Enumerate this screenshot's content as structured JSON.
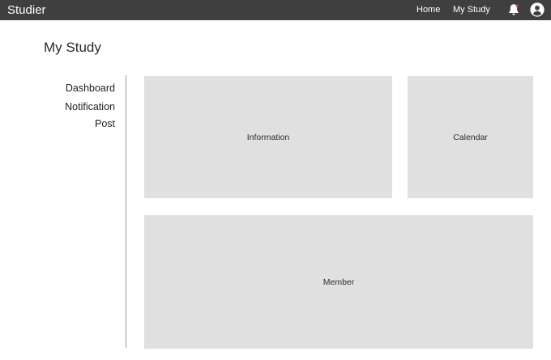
{
  "header": {
    "brand": "Studier",
    "nav": {
      "home": "Home",
      "my_study": "My Study"
    },
    "icons": {
      "notifications": "bell-icon",
      "account": "user-circle-icon"
    },
    "bell_dot_color": "#e0403a"
  },
  "page": {
    "title": "My Study"
  },
  "sidebar": {
    "items": [
      {
        "label": "Dashboard"
      },
      {
        "label": "Notification"
      },
      {
        "label": "Post"
      }
    ]
  },
  "panels": {
    "information": "Information",
    "calendar": "Calendar",
    "member": "Member"
  }
}
